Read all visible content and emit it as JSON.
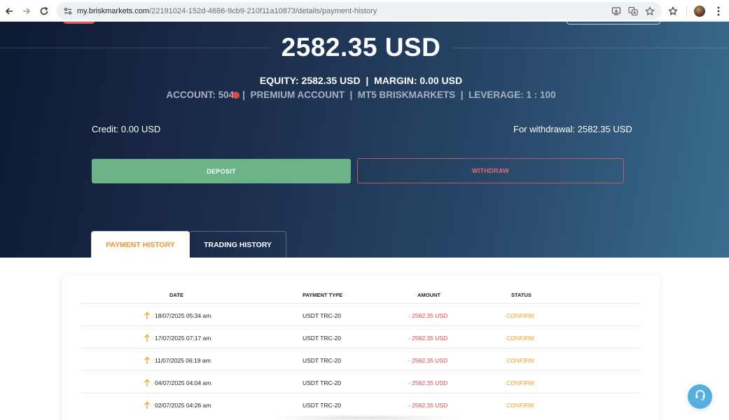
{
  "browser": {
    "url_host": "my.briskmarkets.com",
    "url_path": "/22191024-152d-4686-9cb9-210f11a10873/details/payment-history"
  },
  "account": {
    "balance": "2582.35 USD",
    "equity_line": "EQUITY: 2582.35 USD  |  MARGIN: 0.00 USD",
    "account_label": "ACCOUNT: 504",
    "account_rest": "|  PREMIUM ACCOUNT  |  MT5 BRISKMARKETS  |  LEVERAGE: 1 : 100",
    "credit": "Credit: 0.00 USD",
    "for_withdrawal": "For withdrawal: 2582.35 USD"
  },
  "actions": {
    "deposit_label": "DEPOSIT",
    "withdraw_label": "WITHDRAW"
  },
  "tabs": [
    {
      "label": "PAYMENT HISTORY",
      "active": true
    },
    {
      "label": "TRADING HISTORY",
      "active": false
    }
  ],
  "table": {
    "headers": [
      "DATE",
      "PAYMENT TYPE",
      "AMOUNT",
      "STATUS"
    ],
    "rows": [
      {
        "date": "18/07/2025 05:34 am",
        "type": "USDT TRC-20",
        "amount": "- 2582.35 USD",
        "status": "CONFIRM"
      },
      {
        "date": "17/07/2025 07:17 am",
        "type": "USDT TRC-20",
        "amount": "- 2582.35 USD",
        "status": "CONFIRM"
      },
      {
        "date": "11/07/2025 06:19 am",
        "type": "USDT TRC-20",
        "amount": "- 2582.35 USD",
        "status": "CONFIRM"
      },
      {
        "date": "04/07/2025 04:04 am",
        "type": "USDT TRC-20",
        "amount": "- 2582.35 USD",
        "status": "CONFIRM"
      },
      {
        "date": "02/07/2025 04:26 am",
        "type": "USDT TRC-20",
        "amount": "- 2582.35 USD",
        "status": "CONFIRM"
      }
    ]
  },
  "colors": {
    "deposit": "#6cb389",
    "withdraw": "#e06a72",
    "active_tab": "#e6963b",
    "amount_negative": "#e5484d",
    "status_confirm": "#f2a12e",
    "support": "#55b0e0"
  },
  "icons": {
    "support": "headset-icon",
    "row_arrow": "arrow-up-icon"
  }
}
